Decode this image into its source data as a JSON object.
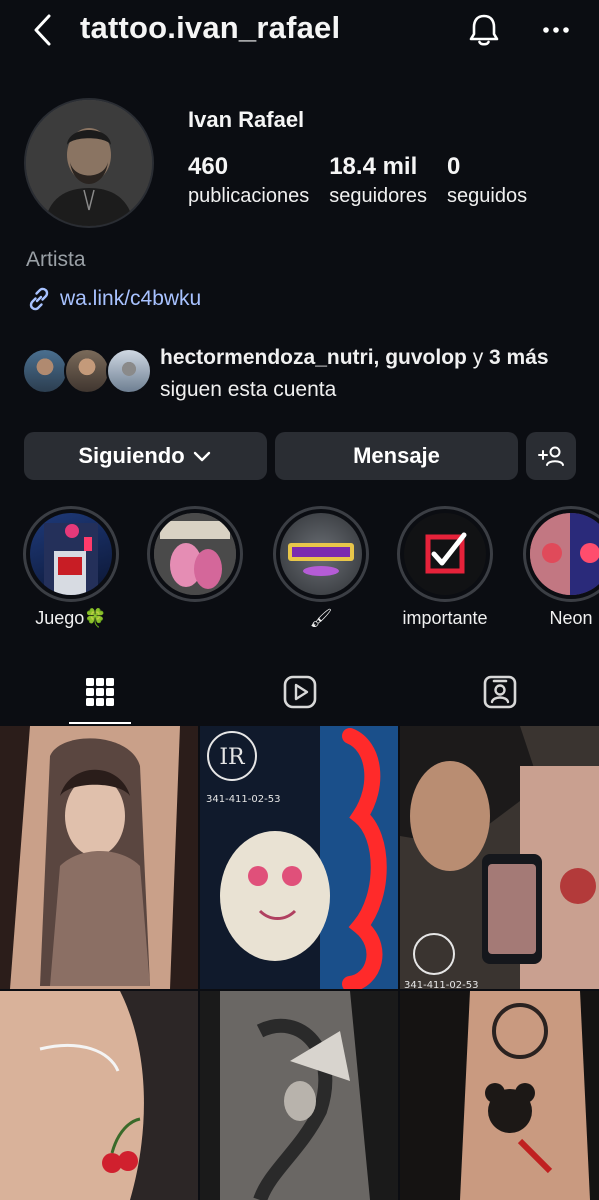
{
  "header": {
    "username": "tattoo.ivan_rafael"
  },
  "profile": {
    "display_name": "Ivan Rafael",
    "stats": [
      {
        "value": "460",
        "label": "publicaciones"
      },
      {
        "value": "18.4 mil",
        "label": "seguidores"
      },
      {
        "value": "0",
        "label": "seguidos"
      }
    ],
    "category": "Artista",
    "link": "wa.link/c4bwku"
  },
  "followed_by": {
    "names": "hectormendoza_nutri, guvolop",
    "connector": " y ",
    "count": "3 más",
    "suffix": " siguen esta cuenta"
  },
  "actions": {
    "following_label": "Siguiendo",
    "message_label": "Mensaje"
  },
  "highlights": [
    {
      "label": "Juego🍀",
      "icon": "arcade-icon"
    },
    {
      "label": "",
      "icon": "pink-panther-icon"
    },
    {
      "label": "🖌",
      "icon": "la-calavera-logo"
    },
    {
      "label": "importante",
      "icon": "checkbox-icon"
    },
    {
      "label": "Neon",
      "icon": "neon-sign-icon"
    }
  ],
  "tabs": [
    {
      "name": "grid",
      "icon": "grid-icon"
    },
    {
      "name": "reels",
      "icon": "reels-icon"
    },
    {
      "name": "tagged",
      "icon": "tagged-icon"
    }
  ],
  "posts": [
    {
      "watermark": ""
    },
    {
      "watermark": "341-411-02-53"
    },
    {
      "watermark": "341-411-02-53"
    },
    {
      "watermark": ""
    },
    {
      "watermark": ""
    },
    {
      "watermark": ""
    }
  ],
  "colors": {
    "background": "#0b0d12",
    "button": "#2a2d33",
    "link": "#a8c2ff",
    "muted": "#9aa0a6"
  }
}
